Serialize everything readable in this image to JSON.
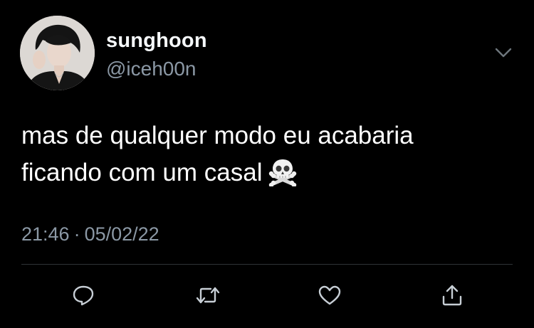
{
  "user": {
    "display_name": "sunghoon",
    "handle": "@iceh00n",
    "avatar_icon": "profile-photo"
  },
  "tweet": {
    "lines": [
      "mas de qualquer modo eu acabaria",
      "ficando com um casal"
    ],
    "emoji": "skull-and-crossbones",
    "time": "21:46",
    "separator": "·",
    "date": "05/02/22"
  },
  "actions": {
    "reply_icon": "speech-bubble-icon",
    "retweet_icon": "retweet-icon",
    "like_icon": "heart-icon",
    "share_icon": "share-icon"
  },
  "colors": {
    "background": "#000000",
    "text": "#ffffff",
    "secondary": "#8b98a5",
    "divider": "#2f3336"
  }
}
